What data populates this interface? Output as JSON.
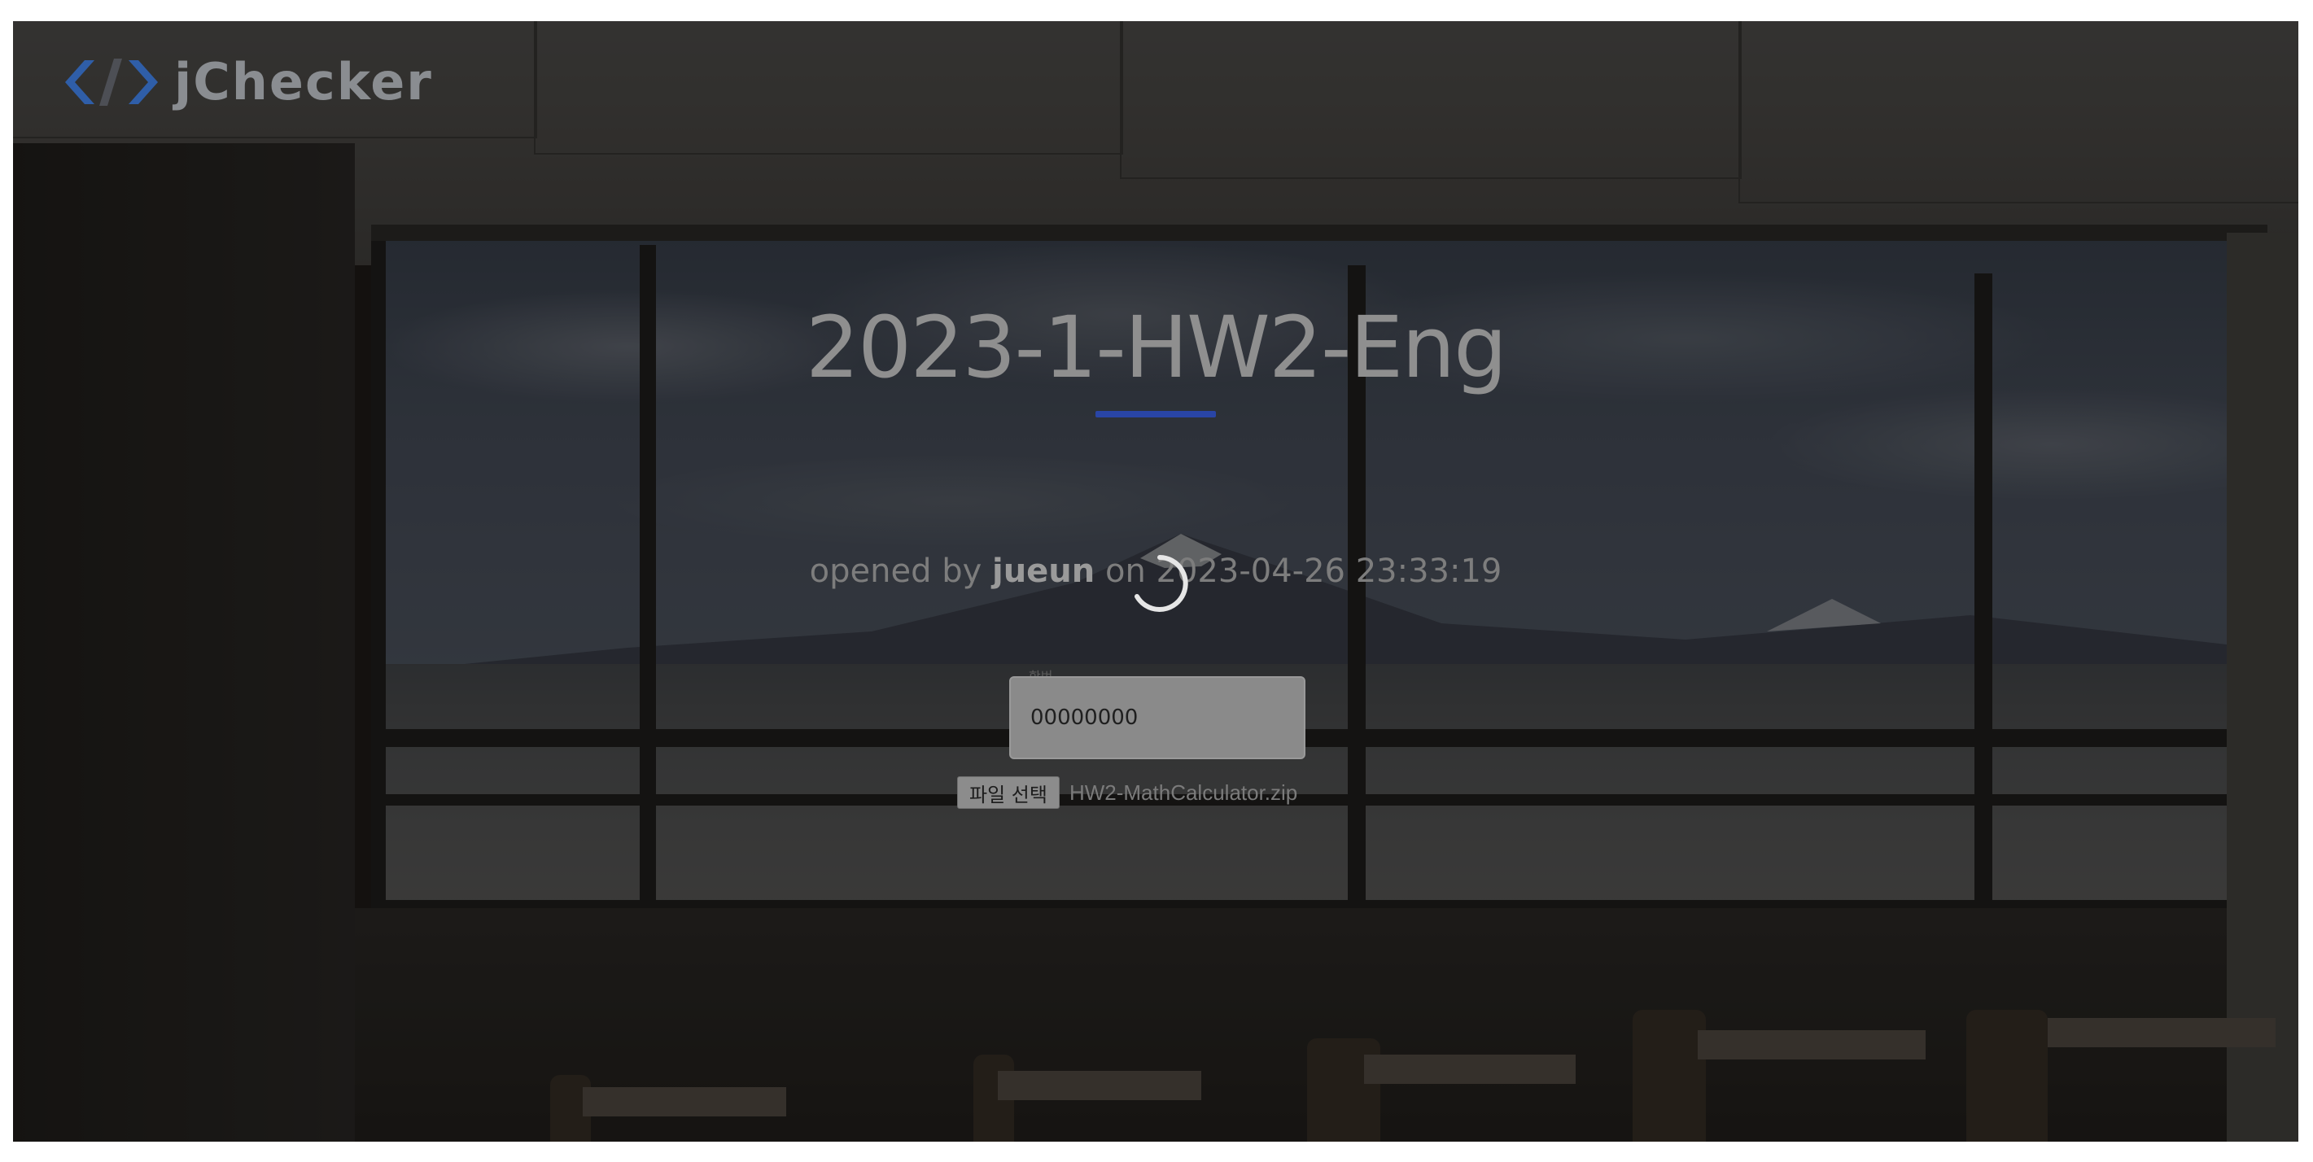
{
  "header": {
    "logo_text": "jChecker",
    "logo_icon": "code-brackets-icon"
  },
  "main": {
    "title": "2023-1-HW2-Eng",
    "opened_prefix": "opened by ",
    "opened_user": "jueun",
    "opened_suffix": " on 2023-04-26 23:33:19",
    "loading_icon": "loading-spinner-icon"
  },
  "form": {
    "id_label": "학번",
    "id_value": "00000000",
    "file_button_label": "파일 선택",
    "file_name": "HW2-MathCalculator.zip"
  },
  "colors": {
    "accent_underline": "#2945a6",
    "logo_icon_blue": "#2f5ea8"
  }
}
